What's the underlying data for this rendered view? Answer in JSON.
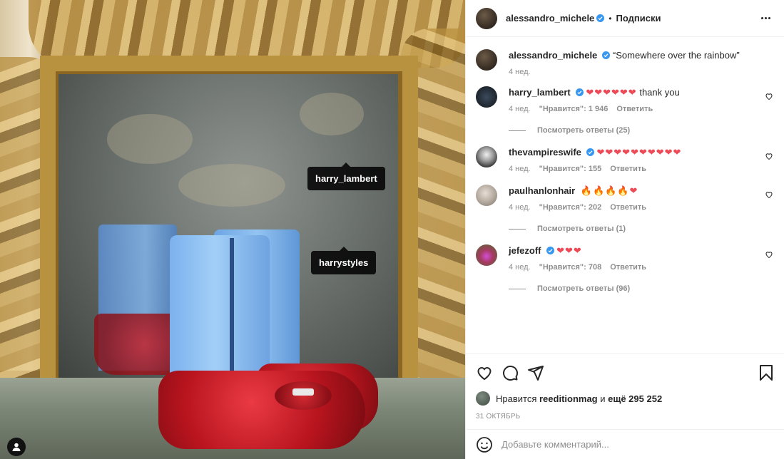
{
  "photo": {
    "tags": [
      "harry_lambert",
      "harrystyles"
    ]
  },
  "header": {
    "username": "alessandro_michele",
    "separator": "•",
    "follow_label": "Подписки"
  },
  "caption": {
    "username": "alessandro_michele",
    "text": "“Somewhere over the rainbow”",
    "time": "4 нед."
  },
  "comments": [
    {
      "username": "harry_lambert",
      "hearts": "❤❤❤❤❤❤",
      "text": "thank you",
      "time": "4 нед.",
      "likes": "\"Нравится\": 1 946",
      "reply": "Ответить",
      "replies": "Посмотреть ответы (25)"
    },
    {
      "username": "thevampireswife",
      "hearts": "❤❤❤❤❤❤❤❤❤❤",
      "text": "",
      "time": "4 нед.",
      "likes": "\"Нравится\": 155",
      "reply": "Ответить",
      "replies": ""
    },
    {
      "username": "paulhanlonhair",
      "hearts": "🔥🔥🔥🔥❤",
      "text": "",
      "time": "4 нед.",
      "likes": "\"Нравится\": 202",
      "reply": "Ответить",
      "replies": "Посмотреть ответы (1)"
    },
    {
      "username": "jefezoff",
      "hearts": "❤❤❤",
      "text": "",
      "time": "4 нед.",
      "likes": "\"Нравится\": 708",
      "reply": "Ответить",
      "replies": "Посмотреть ответы (96)"
    }
  ],
  "likes": {
    "prefix": "Нравится",
    "user": "reeditionmag",
    "middle": "и",
    "rest": "ещё 295 252"
  },
  "date": "31 ОКТЯБРЬ",
  "add_comment": {
    "placeholder": "Добавьте комментарий..."
  },
  "colors": {
    "verified": "#3897f0",
    "heart": "#ed4956",
    "muted": "#8e8e8e",
    "text": "#262626"
  },
  "icons": [
    "heart-icon",
    "comment-icon",
    "share-icon",
    "bookmark-icon",
    "smile-icon",
    "more-icon",
    "user-tag-icon",
    "verified-icon"
  ]
}
